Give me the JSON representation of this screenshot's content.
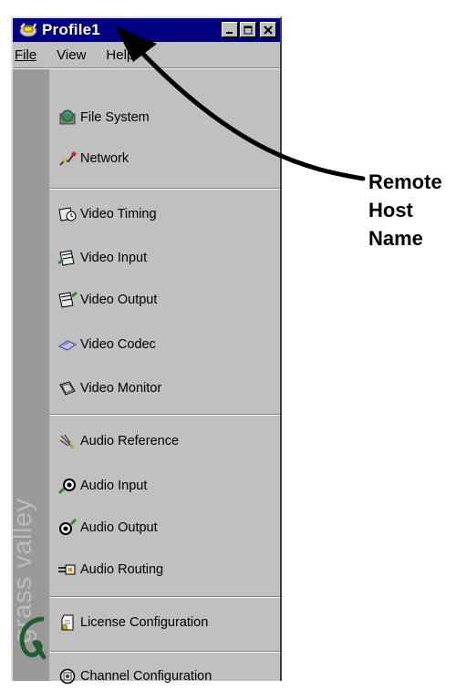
{
  "window": {
    "title": "Profile1",
    "menu": [
      "File",
      "View",
      "Help"
    ]
  },
  "sidebar": {
    "brand": "grass valley",
    "groups": [
      {
        "items": [
          {
            "label": "File System",
            "icon": "file-system-icon"
          },
          {
            "label": "Network",
            "icon": "network-icon"
          }
        ]
      },
      {
        "items": [
          {
            "label": "Video Timing",
            "icon": "video-timing-icon"
          },
          {
            "label": "Video Input",
            "icon": "video-input-icon"
          },
          {
            "label": "Video Output",
            "icon": "video-output-icon"
          },
          {
            "label": "Video Codec",
            "icon": "video-codec-icon"
          },
          {
            "label": "Video Monitor",
            "icon": "video-monitor-icon"
          }
        ]
      },
      {
        "items": [
          {
            "label": "Audio Reference",
            "icon": "audio-reference-icon"
          },
          {
            "label": "Audio Input",
            "icon": "audio-input-icon"
          },
          {
            "label": "Audio Output",
            "icon": "audio-output-icon"
          },
          {
            "label": "Audio Routing",
            "icon": "audio-routing-icon"
          }
        ]
      },
      {
        "items": [
          {
            "label": "License Configuration",
            "icon": "license-icon"
          }
        ]
      },
      {
        "items": [
          {
            "label": "Channel Configuration",
            "icon": "channel-icon"
          }
        ]
      }
    ]
  },
  "annotation": {
    "lines": [
      "Remote",
      "Host",
      "Name"
    ]
  },
  "colors": {
    "titlebar": "#000080",
    "window": "#c0c0c0",
    "strip": "#999999"
  }
}
